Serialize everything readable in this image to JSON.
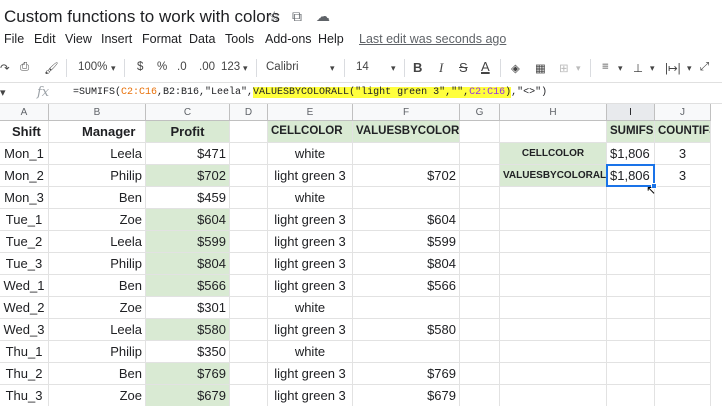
{
  "app": {
    "title": "Custom functions to work with colors",
    "star_icon": "star-icon",
    "move_icon": "folder-move-icon",
    "cloud_icon": "cloud-status-icon"
  },
  "menu": {
    "items": [
      "File",
      "Edit",
      "View",
      "Insert",
      "Format",
      "Data",
      "Tools",
      "Add-ons",
      "Help"
    ],
    "last_edit": "Last edit was seconds ago"
  },
  "toolbar": {
    "zoom": "100%",
    "currency": "$",
    "percent": "%",
    "dec_decrease": ".0",
    "dec_increase": ".00",
    "more_formats": "123",
    "font": "Calibri",
    "font_size": "14",
    "bold": "B",
    "italic": "I",
    "strike": "S",
    "text_color": "A"
  },
  "formula_bar": {
    "cell_ref": "I3",
    "fx": "fx",
    "part1": "=SUMIFS(",
    "ref1": "C2:C16",
    "part2": ",B2:B16,\"Leela\",",
    "hl1": "VALUESBYCOLORALL(\"light green 3\",\"\",",
    "hl_ref": "C2:C16",
    "hl2": ")",
    "part3": ",\"<>\")"
  },
  "columns": [
    "A",
    "B",
    "C",
    "D",
    "E",
    "F",
    "G",
    "H",
    "I",
    "J"
  ],
  "headers": {
    "A": "Shift",
    "B": "Manager",
    "C": "Profit",
    "E": "CELLCOLOR",
    "F": "VALUESBYCOLORALL",
    "I": "SUMIFS",
    "J": "COUNTIFS"
  },
  "rows": [
    {
      "shift": "Mon_1",
      "manager": "Leela",
      "profit": "$471",
      "color": "white",
      "value": ""
    },
    {
      "shift": "Mon_2",
      "manager": "Philip",
      "profit": "$702",
      "color": "light green 3",
      "value": "$702"
    },
    {
      "shift": "Mon_3",
      "manager": "Ben",
      "profit": "$459",
      "color": "white",
      "value": ""
    },
    {
      "shift": "Tue_1",
      "manager": "Zoe",
      "profit": "$604",
      "color": "light green 3",
      "value": "$604"
    },
    {
      "shift": "Tue_2",
      "manager": "Leela",
      "profit": "$599",
      "color": "light green 3",
      "value": "$599"
    },
    {
      "shift": "Tue_3",
      "manager": "Philip",
      "profit": "$804",
      "color": "light green 3",
      "value": "$804"
    },
    {
      "shift": "Wed_1",
      "manager": "Ben",
      "profit": "$566",
      "color": "light green 3",
      "value": "$566"
    },
    {
      "shift": "Wed_2",
      "manager": "Zoe",
      "profit": "$301",
      "color": "white",
      "value": ""
    },
    {
      "shift": "Wed_3",
      "manager": "Leela",
      "profit": "$580",
      "color": "light green 3",
      "value": "$580"
    },
    {
      "shift": "Thu_1",
      "manager": "Philip",
      "profit": "$350",
      "color": "white",
      "value": ""
    },
    {
      "shift": "Thu_2",
      "manager": "Ben",
      "profit": "$769",
      "color": "light green 3",
      "value": "$769"
    },
    {
      "shift": "Thu_3",
      "manager": "Zoe",
      "profit": "$679",
      "color": "light green 3",
      "value": "$679"
    }
  ],
  "summary": [
    {
      "label": "CELLCOLOR",
      "sumifs": "$1,806",
      "countifs": "3"
    },
    {
      "label": "VALUESBYCOLORALL",
      "sumifs": "$1,806",
      "countifs": "3"
    }
  ],
  "colors": {
    "green_fill": "#d9ead3",
    "selection": "#1a73e8",
    "formula_highlight": "#ffff3d"
  }
}
